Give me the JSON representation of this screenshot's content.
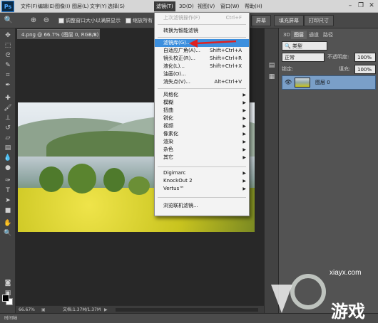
{
  "app": {
    "logo": "Ps"
  },
  "menubar": {
    "items": [
      "文件(F)",
      "编辑(E)",
      "图像(I)",
      "图层(L)",
      "文字(Y)",
      "选择(S)",
      "滤镜(T)",
      "3D(D)",
      "视图(V)",
      "窗口(W)",
      "帮助(H)"
    ],
    "active": "滤镜(T)"
  },
  "options": {
    "resize_windows_label": "调整窗口大小以满屏显示",
    "zoom_all_label": "缩放所有",
    "fill_screen_label": "填充屏幕",
    "print_size_label": "打印尺寸",
    "partial_screen_label": "屏幕"
  },
  "document": {
    "tab_title": "4.png @ 66.7% (图层 0, RGB/8)",
    "zoom": "66.67%",
    "doc_info": "文档:1.37M/1.37M"
  },
  "timeline": {
    "label": "时间轴"
  },
  "filter_menu": {
    "items": [
      {
        "label": "上次滤镜操作(F)",
        "shortcut": "Ctrl+F",
        "disabled": true
      },
      {
        "separator": true
      },
      {
        "label": "转换为智能滤镜"
      },
      {
        "separator": true
      },
      {
        "label": "滤镜库(G)...",
        "highlighted": true
      },
      {
        "label": "自适应广角(A)...",
        "shortcut": "Shift+Ctrl+A"
      },
      {
        "label": "镜头校正(R)...",
        "shortcut": "Shift+Ctrl+R"
      },
      {
        "label": "液化(L)...",
        "shortcut": "Shift+Ctrl+X"
      },
      {
        "label": "油画(O)..."
      },
      {
        "label": "消失点(V)...",
        "shortcut": "Alt+Ctrl+V"
      },
      {
        "separator": true
      },
      {
        "label": "风格化",
        "submenu": true
      },
      {
        "label": "模糊",
        "submenu": true
      },
      {
        "label": "扭曲",
        "submenu": true
      },
      {
        "label": "锐化",
        "submenu": true
      },
      {
        "label": "视频",
        "submenu": true
      },
      {
        "label": "像素化",
        "submenu": true
      },
      {
        "label": "渲染",
        "submenu": true
      },
      {
        "label": "杂色",
        "submenu": true
      },
      {
        "label": "其它",
        "submenu": true
      },
      {
        "separator": true
      },
      {
        "label": "Digimarc",
        "submenu": true
      },
      {
        "label": "KnockOut 2",
        "submenu": true
      },
      {
        "label": "Vertus™",
        "submenu": true
      },
      {
        "separator": true
      },
      {
        "label": "浏览联机滤镜..."
      }
    ]
  },
  "layers_panel": {
    "tabs": [
      "3D",
      "图层",
      "通道",
      "路径"
    ],
    "filter_kind": "类型",
    "blend_mode": "正常",
    "opacity_label": "不透明度:",
    "opacity_value": "100%",
    "lock_label": "锁定:",
    "fill_label": "填充:",
    "fill_value": "100%",
    "layer_name": "图层 0"
  },
  "watermark": {
    "brand": "xiayx.com",
    "sub": "游戏"
  },
  "colors": {
    "menu_highlight": "#3c8fde",
    "arrow": "#e02020"
  }
}
